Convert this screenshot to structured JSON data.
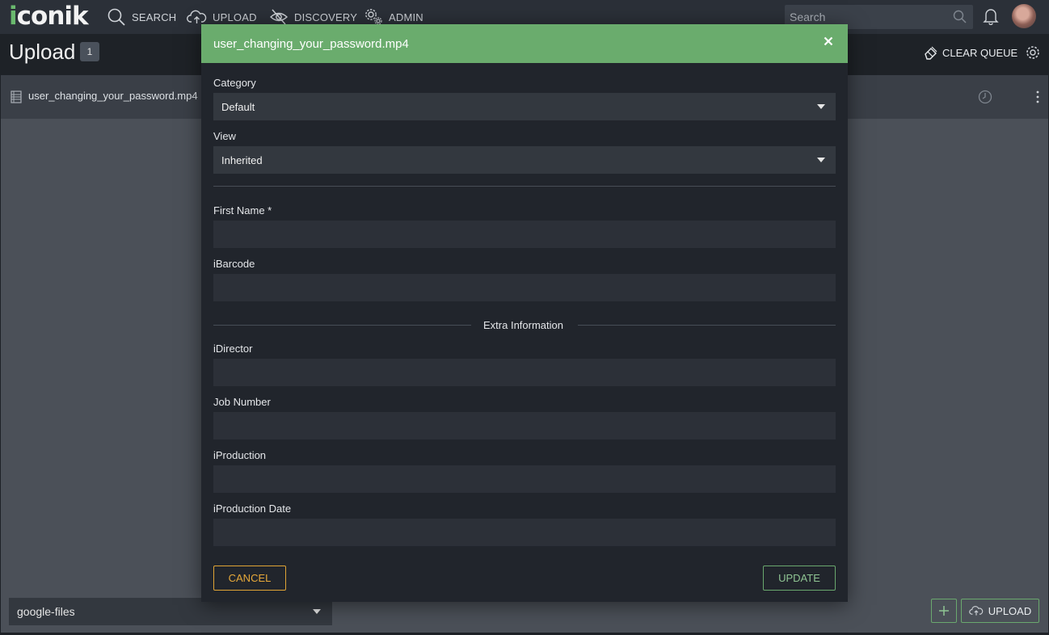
{
  "app": {
    "logo_prefix": "i",
    "logo_rest": "conik"
  },
  "nav": {
    "search_label": "SEARCH",
    "upload_label": "UPLOAD",
    "discovery_label": "DISCOVERY",
    "admin_label": "ADMIN",
    "search_placeholder": "Search"
  },
  "page": {
    "title": "Upload",
    "count": "1",
    "clear_queue_label": "CLEAR QUEUE"
  },
  "queue": {
    "items": [
      {
        "name": "user_changing_your_password.mp4"
      }
    ]
  },
  "footer": {
    "storage_value": "google-files",
    "upload_label": "UPLOAD"
  },
  "modal": {
    "title": "user_changing_your_password.mp4",
    "category_label": "Category",
    "category_value": "Default",
    "view_label": "View",
    "view_value": "Inherited",
    "fields": {
      "first_name": "First Name *",
      "ibarcode": "iBarcode",
      "section_title": "Extra Information",
      "idirector": "iDirector",
      "job_number": "Job Number",
      "iproduction": "iProduction",
      "iproduction_date": "iProduction Date"
    },
    "cancel_label": "CANCEL",
    "update_label": "UPDATE"
  },
  "colors": {
    "accent_green": "#6aac6d",
    "cancel_orange": "#e7a93a",
    "background": "#1e2227"
  }
}
